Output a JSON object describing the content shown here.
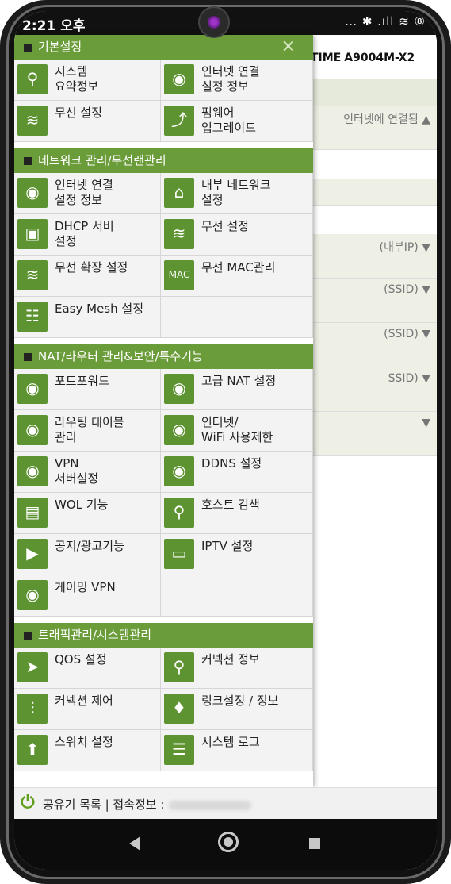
{
  "status": {
    "time": "2:21 오후",
    "icons": "… ✱ .ıll ≋ ⑧",
    "battery": "81"
  },
  "background": {
    "brand": "TIME",
    "model": "A9004M-X2",
    "internet_status": "인터넷에 연결됨 ▲",
    "rows": [
      {
        "value": "(내부IP) ▼"
      },
      {
        "value": "(SSID) ▼"
      },
      {
        "value": "(SSID) ▼"
      },
      {
        "value": "SSID) ▼"
      },
      {
        "value": "▼"
      }
    ]
  },
  "drawer": {
    "close_label": "✕",
    "sections": [
      {
        "title": "기본설정",
        "items": [
          {
            "label": "시스템\n요약정보",
            "icon": "magnifier-icon"
          },
          {
            "label": "인터넷 연결\n설정 정보",
            "icon": "globe-icon"
          },
          {
            "label": "무선 설정",
            "icon": "wifi-icon"
          },
          {
            "label": "펌웨어\n업그레이드",
            "icon": "upgrade-icon"
          }
        ]
      },
      {
        "title": "네트워크 관리/무선랜관리",
        "items": [
          {
            "label": "인터넷 연결\n설정 정보",
            "icon": "globe-icon"
          },
          {
            "label": "내부 네트워크\n설정",
            "icon": "lan-icon"
          },
          {
            "label": "DHCP 서버\n설정",
            "icon": "dhcp-icon"
          },
          {
            "label": "무선 설정",
            "icon": "wifi-icon"
          },
          {
            "label": "무선 확장 설정",
            "icon": "wifi-extend-icon"
          },
          {
            "label": "무선 MAC관리",
            "icon": "mac-icon"
          },
          {
            "label": "Easy Mesh 설정",
            "icon": "mesh-icon"
          },
          {
            "label": "",
            "icon": ""
          }
        ]
      },
      {
        "title": "NAT/라우터 관리&보안/특수기능",
        "items": [
          {
            "label": "포트포워드",
            "icon": "port-forward-icon"
          },
          {
            "label": "고급 NAT 설정",
            "icon": "nat-icon"
          },
          {
            "label": "라우팅 테이블\n관리",
            "icon": "routing-icon"
          },
          {
            "label": "인터넷/\nWiFi 사용제한",
            "icon": "restrict-icon"
          },
          {
            "label": "VPN\n서버설정",
            "icon": "vpn-icon"
          },
          {
            "label": "DDNS 설정",
            "icon": "ddns-icon"
          },
          {
            "label": "WOL 기능",
            "icon": "wol-icon"
          },
          {
            "label": "호스트 검색",
            "icon": "host-search-icon"
          },
          {
            "label": "공지/광고기능",
            "icon": "notice-icon"
          },
          {
            "label": "IPTV 설정",
            "icon": "iptv-icon"
          },
          {
            "label": "게이밍 VPN",
            "icon": "gaming-vpn-icon"
          },
          {
            "label": "",
            "icon": ""
          }
        ]
      },
      {
        "title": "트래픽관리/시스템관리",
        "items": [
          {
            "label": "QOS 설정",
            "icon": "qos-icon"
          },
          {
            "label": "커넥션 정보",
            "icon": "magnifier-icon"
          },
          {
            "label": "커넥션 제어",
            "icon": "connection-control-icon"
          },
          {
            "label": "링크설정 / 정보",
            "icon": "link-icon"
          },
          {
            "label": "스위치 설정",
            "icon": "switch-icon"
          },
          {
            "label": "시스템 로그",
            "icon": "log-icon"
          }
        ]
      }
    ]
  },
  "footer": {
    "router_list": "공유기 목록",
    "separator": "|",
    "access_info": "접속정보 :"
  },
  "colors": {
    "accent": "#6b9c3a",
    "icon_bg": "#5e9332",
    "power": "#5f9f1b"
  }
}
